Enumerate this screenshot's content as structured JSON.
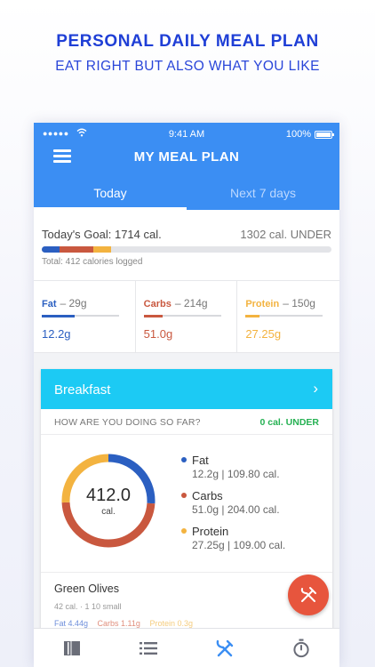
{
  "promo": {
    "title": "PERSONAL DAILY MEAL PLAN",
    "subtitle": "EAT RIGHT BUT ALSO WHAT YOU LIKE"
  },
  "status_bar": {
    "signal": "●●●●●",
    "time": "9:41 AM",
    "battery": "100%"
  },
  "header": {
    "title": "MY MEAL PLAN",
    "menu_icon": "hamburger-menu-icon"
  },
  "tabs": [
    {
      "label": "Today",
      "active": true
    },
    {
      "label": "Next 7 days",
      "active": false
    }
  ],
  "goal": {
    "label": "Today's Goal: 1714 cal.",
    "under": "1302 cal. UNDER",
    "total": "Total: 412 calories logged",
    "progress_fraction": 0.24
  },
  "macros": [
    {
      "name": "Fat",
      "goal": "– 29g",
      "value": "12.2g",
      "progress": 0.42,
      "color": "#2b5fc1"
    },
    {
      "name": "Carbs",
      "goal": "– 214g",
      "value": "51.0g",
      "progress": 0.24,
      "color": "#c9583f"
    },
    {
      "name": "Protein",
      "goal": "– 150g",
      "value": "27.25g",
      "progress": 0.18,
      "color": "#f3b340"
    }
  ],
  "breakfast": {
    "title": "Breakfast",
    "so_far_label": "HOW ARE YOU DOING SO FAR?",
    "so_far_value": "0 cal. UNDER",
    "total_value": "412.0",
    "total_unit": "cal.",
    "legend": [
      {
        "name": "Fat",
        "detail": "12.2g | 109.80 cal.",
        "color": "#2b5fc1",
        "cal": 109.8
      },
      {
        "name": "Carbs",
        "detail": "51.0g | 204.00 cal.",
        "color": "#c9583f",
        "cal": 204.0
      },
      {
        "name": "Protein",
        "detail": "27.25g | 109.00 cal.",
        "color": "#f3b340",
        "cal": 109.0
      }
    ]
  },
  "food_item": {
    "name": "Green Olives",
    "meta": "42 cal. · 1 10 small",
    "fat": "Fat 4.44g",
    "carbs": "Carbs 1.11g",
    "protein": "Protein 0.3g"
  },
  "fab": {
    "icon": "fork-knife-icon"
  },
  "bottom_nav": [
    {
      "icon": "book-icon"
    },
    {
      "icon": "list-icon"
    },
    {
      "icon": "fork-knife-icon",
      "active": true
    },
    {
      "icon": "stopwatch-icon"
    }
  ],
  "colors": {
    "accent_blue": "#3b8ef3",
    "breakfast_header": "#1ccaf4",
    "fat": "#2b5fc1",
    "carbs": "#c9583f",
    "protein": "#f3b340",
    "under_green": "#26b153",
    "fab_red": "#e7553d"
  }
}
